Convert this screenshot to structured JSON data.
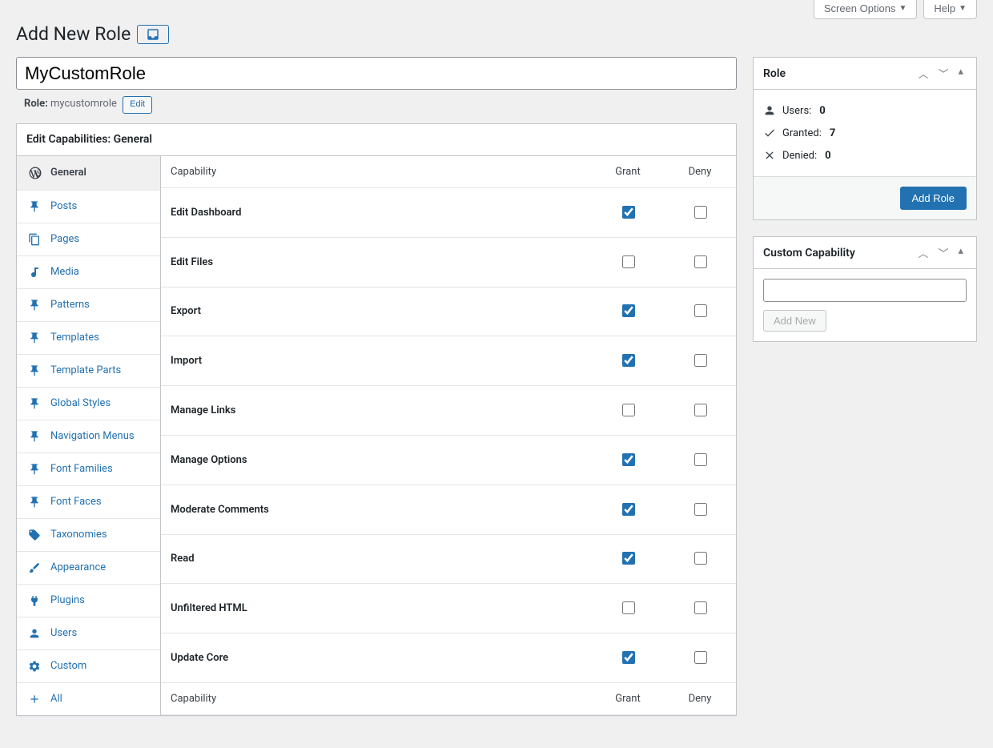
{
  "top": {
    "screen_options": "Screen Options",
    "help": "Help"
  },
  "page_title": "Add New Role",
  "title_input_value": "MyCustomRole",
  "slug": {
    "label": "Role:",
    "value": "mycustomrole",
    "edit": "Edit"
  },
  "edit_caps_title": "Edit Capabilities: General",
  "tabs": [
    {
      "label": "General",
      "icon": "wordpress",
      "active": true
    },
    {
      "label": "Posts",
      "icon": "pin"
    },
    {
      "label": "Pages",
      "icon": "pages"
    },
    {
      "label": "Media",
      "icon": "media"
    },
    {
      "label": "Patterns",
      "icon": "pin"
    },
    {
      "label": "Templates",
      "icon": "pin"
    },
    {
      "label": "Template Parts",
      "icon": "pin"
    },
    {
      "label": "Global Styles",
      "icon": "pin"
    },
    {
      "label": "Navigation Menus",
      "icon": "pin"
    },
    {
      "label": "Font Families",
      "icon": "pin"
    },
    {
      "label": "Font Faces",
      "icon": "pin"
    },
    {
      "label": "Taxonomies",
      "icon": "tag"
    },
    {
      "label": "Appearance",
      "icon": "brush"
    },
    {
      "label": "Plugins",
      "icon": "plug"
    },
    {
      "label": "Users",
      "icon": "user"
    },
    {
      "label": "Custom",
      "icon": "gear"
    },
    {
      "label": "All",
      "icon": "plus"
    }
  ],
  "cap_headers": {
    "cap": "Capability",
    "grant": "Grant",
    "deny": "Deny"
  },
  "capabilities": [
    {
      "name": "Edit Dashboard",
      "grant": true,
      "deny": false
    },
    {
      "name": "Edit Files",
      "grant": false,
      "deny": false
    },
    {
      "name": "Export",
      "grant": true,
      "deny": false
    },
    {
      "name": "Import",
      "grant": true,
      "deny": false
    },
    {
      "name": "Manage Links",
      "grant": false,
      "deny": false
    },
    {
      "name": "Manage Options",
      "grant": true,
      "deny": false
    },
    {
      "name": "Moderate Comments",
      "grant": true,
      "deny": false
    },
    {
      "name": "Read",
      "grant": true,
      "deny": false
    },
    {
      "name": "Unfiltered HTML",
      "grant": false,
      "deny": false
    },
    {
      "name": "Update Core",
      "grant": true,
      "deny": false
    }
  ],
  "role_box": {
    "title": "Role",
    "users_label": "Users:",
    "users_value": "0",
    "granted_label": "Granted:",
    "granted_value": "7",
    "denied_label": "Denied:",
    "denied_value": "0",
    "submit": "Add Role"
  },
  "custom_box": {
    "title": "Custom Capability",
    "add_new": "Add New"
  }
}
